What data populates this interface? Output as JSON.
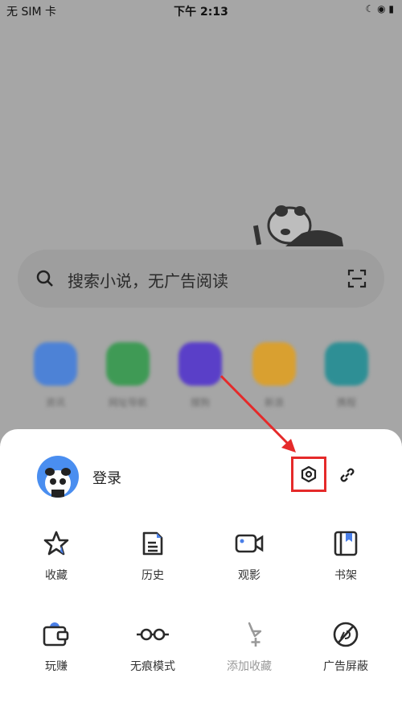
{
  "status": {
    "carrier": "无 SIM 卡",
    "time": "下午 2:13"
  },
  "search": {
    "placeholder": "搜索小说，无广告阅读"
  },
  "apps": [
    {
      "label": "资讯",
      "color": "#4d82d6"
    },
    {
      "label": "网址导航",
      "color": "#3f9a55"
    },
    {
      "label": "搜狗",
      "color": "#5a3fc8"
    },
    {
      "label": "新浪",
      "color": "#d9a030"
    },
    {
      "label": "携程",
      "color": "#2e8f95"
    }
  ],
  "sheet": {
    "login": "登录",
    "items": [
      {
        "label": "收藏",
        "icon": "star-icon"
      },
      {
        "label": "历史",
        "icon": "document-icon"
      },
      {
        "label": "观影",
        "icon": "video-camera-icon"
      },
      {
        "label": "书架",
        "icon": "bookshelf-icon"
      },
      {
        "label": "玩赚",
        "icon": "wallet-icon"
      },
      {
        "label": "无痕模式",
        "icon": "glasses-icon"
      },
      {
        "label": "添加收藏",
        "icon": "star-plus-icon",
        "disabled": true
      },
      {
        "label": "广告屏蔽",
        "icon": "ad-block-icon"
      }
    ]
  },
  "colors": {
    "accent": "#4a7fe8",
    "highlight": "#e52a2a"
  }
}
